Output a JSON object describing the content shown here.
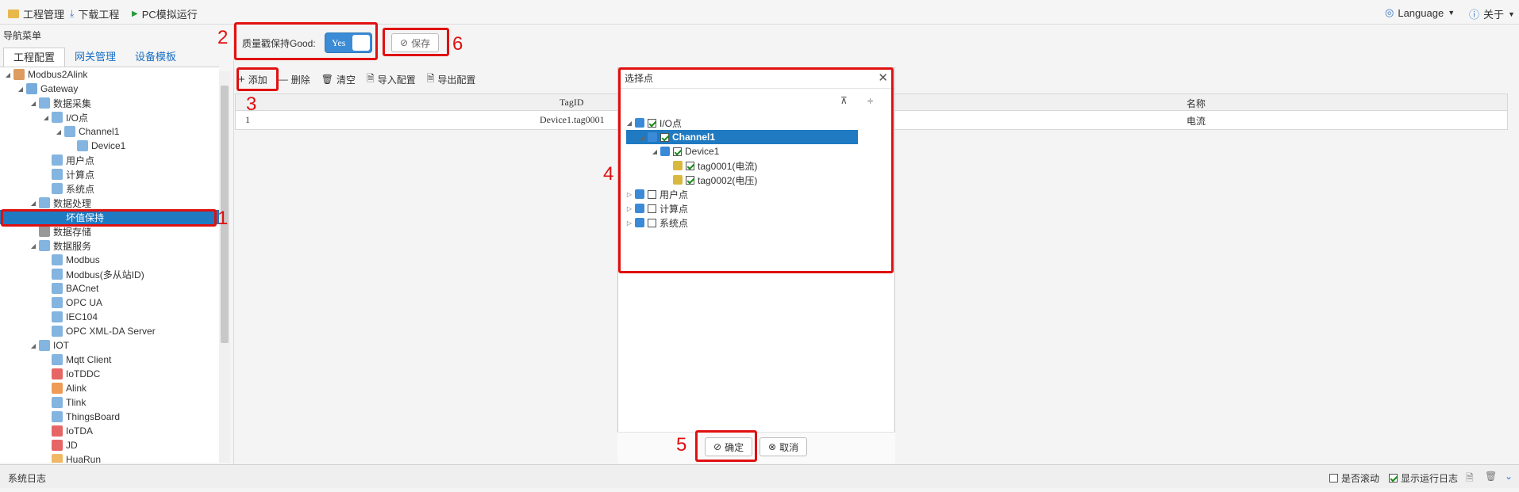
{
  "topbar": {
    "project_mgmt": "工程管理",
    "download": "下载工程",
    "pc_sim": "PC模拟运行",
    "language": "Language",
    "about": "关于"
  },
  "sidebar": {
    "title": "导航菜单",
    "tabs": [
      "工程配置",
      "网关管理",
      "设备模板"
    ],
    "tree": [
      {
        "label": "Modbus2Alink",
        "level": 0,
        "icon": "project-icon"
      },
      {
        "label": "Gateway",
        "level": 1,
        "icon": "gateway-icon"
      },
      {
        "label": "数据采集",
        "level": 2,
        "icon": "data-collect-icon"
      },
      {
        "label": "I/O点",
        "level": 3,
        "icon": "io-icon"
      },
      {
        "label": "Channel1",
        "level": 4,
        "icon": "channel-icon"
      },
      {
        "label": "Device1",
        "level": 5,
        "icon": "device-icon"
      },
      {
        "label": "用户点",
        "level": 3,
        "icon": "user-point-icon"
      },
      {
        "label": "计算点",
        "level": 3,
        "icon": "calc-point-icon"
      },
      {
        "label": "系统点",
        "level": 3,
        "icon": "system-point-icon"
      },
      {
        "label": "数据处理",
        "level": 2,
        "icon": "data-process-icon"
      },
      {
        "label": "坏值保持",
        "level": 3,
        "icon": "",
        "selected": true
      },
      {
        "label": "数据存储",
        "level": 2,
        "icon": "database-icon"
      },
      {
        "label": "数据服务",
        "level": 2,
        "icon": "data-service-icon"
      },
      {
        "label": "Modbus",
        "level": 3,
        "icon": "modbus-icon"
      },
      {
        "label": "Modbus(多从站ID)",
        "level": 3,
        "icon": "modbus-icon"
      },
      {
        "label": "BACnet",
        "level": 3,
        "icon": "bacnet-icon"
      },
      {
        "label": "OPC UA",
        "level": 3,
        "icon": "opcua-icon"
      },
      {
        "label": "IEC104",
        "level": 3,
        "icon": "iec104-icon"
      },
      {
        "label": "OPC XML-DA Server",
        "level": 3,
        "icon": "opcxml-icon"
      },
      {
        "label": "IOT",
        "level": 2,
        "icon": "iot-icon"
      },
      {
        "label": "Mqtt Client",
        "level": 3,
        "icon": "mqtt-icon"
      },
      {
        "label": "IoTDDC",
        "level": 3,
        "icon": "iotddc-icon"
      },
      {
        "label": "Alink",
        "level": 3,
        "icon": "alink-icon"
      },
      {
        "label": "Tlink",
        "level": 3,
        "icon": "tlink-icon"
      },
      {
        "label": "ThingsBoard",
        "level": 3,
        "icon": "thingsboard-icon"
      },
      {
        "label": "IoTDA",
        "level": 3,
        "icon": "iotda-icon"
      },
      {
        "label": "JD",
        "level": 3,
        "icon": "jd-icon"
      },
      {
        "label": "HuaRun",
        "level": 3,
        "icon": "huarun-icon"
      }
    ]
  },
  "main": {
    "quality_label": "质量戳保持Good:",
    "toggle_value": "Yes",
    "save": "保存",
    "toolbar": {
      "add": "添加",
      "delete": "删除",
      "clear": "清空",
      "import": "导入配置",
      "export": "导出配置"
    },
    "grid": {
      "headers": [
        "TagID",
        "名称"
      ],
      "rows": [
        {
          "index": "1",
          "tagid": "Device1.tag0001",
          "name": "电流"
        }
      ]
    }
  },
  "dialog": {
    "title": "选择点",
    "ok": "确定",
    "cancel": "取消",
    "tree": [
      {
        "label": "I/O点",
        "level": 0,
        "checked": true,
        "expanded": true
      },
      {
        "label": "Channel1",
        "level": 1,
        "checked": true,
        "expanded": true,
        "selected": true
      },
      {
        "label": "Device1",
        "level": 2,
        "checked": true,
        "expanded": true
      },
      {
        "label": "tag0001(电流)",
        "level": 3,
        "checked": true
      },
      {
        "label": "tag0002(电压)",
        "level": 3,
        "checked": true
      },
      {
        "label": "用户点",
        "level": 0,
        "checked": false
      },
      {
        "label": "计算点",
        "level": 0,
        "checked": false
      },
      {
        "label": "系统点",
        "level": 0,
        "checked": false
      }
    ]
  },
  "statusbar": {
    "log_title": "系统日志",
    "auto_scroll": "是否滚动",
    "show_runtime_log": "显示运行日志"
  },
  "annotations": [
    "1",
    "2",
    "3",
    "4",
    "5",
    "6"
  ],
  "colors": {
    "accent": "#1f7ac2",
    "annotation": "#e01010"
  }
}
